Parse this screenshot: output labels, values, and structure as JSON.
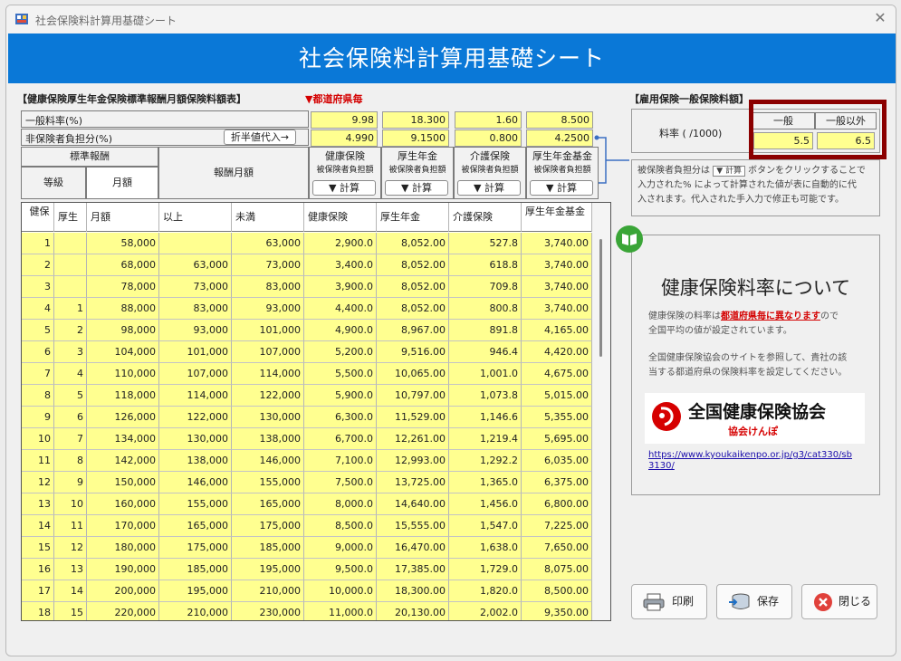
{
  "window": {
    "title": "社会保険料計算用基礎シート",
    "close_icon": "close-icon"
  },
  "banner": {
    "title": "社会保険料計算用基礎シート"
  },
  "left_header": "【健康保険厚生年金保険標準報酬月額保険料額表】",
  "prefecture_note": "▼都道府県毎",
  "rates": {
    "general_label": "一般料率(%)",
    "general_values": [
      "9.98",
      "18.300",
      "1.60",
      "8.500"
    ],
    "insured_label": "非保険者負担分(%)",
    "fill_half_button": "折半値代入→",
    "insured_values": [
      "4.990",
      "9.1500",
      "0.800",
      "4.2500"
    ]
  },
  "header_labels": {
    "standard": "標準報酬",
    "grade": "等級",
    "monthly": "月額",
    "remuneration": "報酬月額",
    "calc_button": "▼ 計算",
    "insurer_share": "被保険者負担額"
  },
  "column_titles": [
    "健康保険",
    "厚生年金",
    "介護保険",
    "厚生年金基金"
  ],
  "grid_header": [
    "健保",
    "厚生",
    "月額",
    "以上",
    "未満",
    "健康保険",
    "厚生年金",
    "介護保険",
    "厚生年金基金"
  ],
  "rows": [
    [
      "1",
      "",
      "58,000",
      "",
      "63,000",
      "2,900.0",
      "8,052.00",
      "527.8",
      "3,740.00"
    ],
    [
      "2",
      "",
      "68,000",
      "63,000",
      "73,000",
      "3,400.0",
      "8,052.00",
      "618.8",
      "3,740.00"
    ],
    [
      "3",
      "",
      "78,000",
      "73,000",
      "83,000",
      "3,900.0",
      "8,052.00",
      "709.8",
      "3,740.00"
    ],
    [
      "4",
      "1",
      "88,000",
      "83,000",
      "93,000",
      "4,400.0",
      "8,052.00",
      "800.8",
      "3,740.00"
    ],
    [
      "5",
      "2",
      "98,000",
      "93,000",
      "101,000",
      "4,900.0",
      "8,967.00",
      "891.8",
      "4,165.00"
    ],
    [
      "6",
      "3",
      "104,000",
      "101,000",
      "107,000",
      "5,200.0",
      "9,516.00",
      "946.4",
      "4,420.00"
    ],
    [
      "7",
      "4",
      "110,000",
      "107,000",
      "114,000",
      "5,500.0",
      "10,065.00",
      "1,001.0",
      "4,675.00"
    ],
    [
      "8",
      "5",
      "118,000",
      "114,000",
      "122,000",
      "5,900.0",
      "10,797.00",
      "1,073.8",
      "5,015.00"
    ],
    [
      "9",
      "6",
      "126,000",
      "122,000",
      "130,000",
      "6,300.0",
      "11,529.00",
      "1,146.6",
      "5,355.00"
    ],
    [
      "10",
      "7",
      "134,000",
      "130,000",
      "138,000",
      "6,700.0",
      "12,261.00",
      "1,219.4",
      "5,695.00"
    ],
    [
      "11",
      "8",
      "142,000",
      "138,000",
      "146,000",
      "7,100.0",
      "12,993.00",
      "1,292.2",
      "6,035.00"
    ],
    [
      "12",
      "9",
      "150,000",
      "146,000",
      "155,000",
      "7,500.0",
      "13,725.00",
      "1,365.0",
      "6,375.00"
    ],
    [
      "13",
      "10",
      "160,000",
      "155,000",
      "165,000",
      "8,000.0",
      "14,640.00",
      "1,456.0",
      "6,800.00"
    ],
    [
      "14",
      "11",
      "170,000",
      "165,000",
      "175,000",
      "8,500.0",
      "15,555.00",
      "1,547.0",
      "7,225.00"
    ],
    [
      "15",
      "12",
      "180,000",
      "175,000",
      "185,000",
      "9,000.0",
      "16,470.00",
      "1,638.0",
      "7,650.00"
    ],
    [
      "16",
      "13",
      "190,000",
      "185,000",
      "195,000",
      "9,500.0",
      "17,385.00",
      "1,729.0",
      "8,075.00"
    ],
    [
      "17",
      "14",
      "200,000",
      "195,000",
      "210,000",
      "10,000.0",
      "18,300.00",
      "1,820.0",
      "8,500.00"
    ],
    [
      "18",
      "15",
      "220,000",
      "210,000",
      "230,000",
      "11,000.0",
      "20,130.00",
      "2,002.0",
      "9,350.00"
    ]
  ],
  "employment": {
    "header": "【雇用保険一般保険料額】",
    "rate_label": "料率 ( /1000)",
    "col_general": "一般",
    "col_other": "一般以外",
    "val_general": "5.5",
    "val_other": "6.5"
  },
  "note": {
    "part1": "被保険者負担分は",
    "button": "▼ 計算",
    "part2": "ボタンをクリックすることで",
    "line2": "入力された% によって計算された値が表に自動的に代",
    "line3": "入されます。代入された手入力で修正も可能です。"
  },
  "info": {
    "title": "健康保険料率について",
    "p1a": "健康保険の料率は",
    "p1link": "都道府県毎に異なります",
    "p1b": "ので",
    "p1c": "全国平均の値が設定されています。",
    "p2a": "全国健康保険協会のサイトを参照して、貴社の該",
    "p2b": "当する都道府県の保険料率を設定してください。",
    "logo_main": "全国健康保険協会",
    "logo_sub": "協会けんぽ",
    "url_line1": "https://www.kyoukaikenpo.or.jp/g3/cat330/sb",
    "url_line2": "3130/"
  },
  "buttons": {
    "print": "印刷",
    "save": "保存",
    "close": "閉じる"
  },
  "colors": {
    "accent": "#0a78d7",
    "yellow": "#ffff90",
    "highlight": "#8b0000",
    "link_red": "#d40000",
    "logo_red": "#d60000"
  }
}
